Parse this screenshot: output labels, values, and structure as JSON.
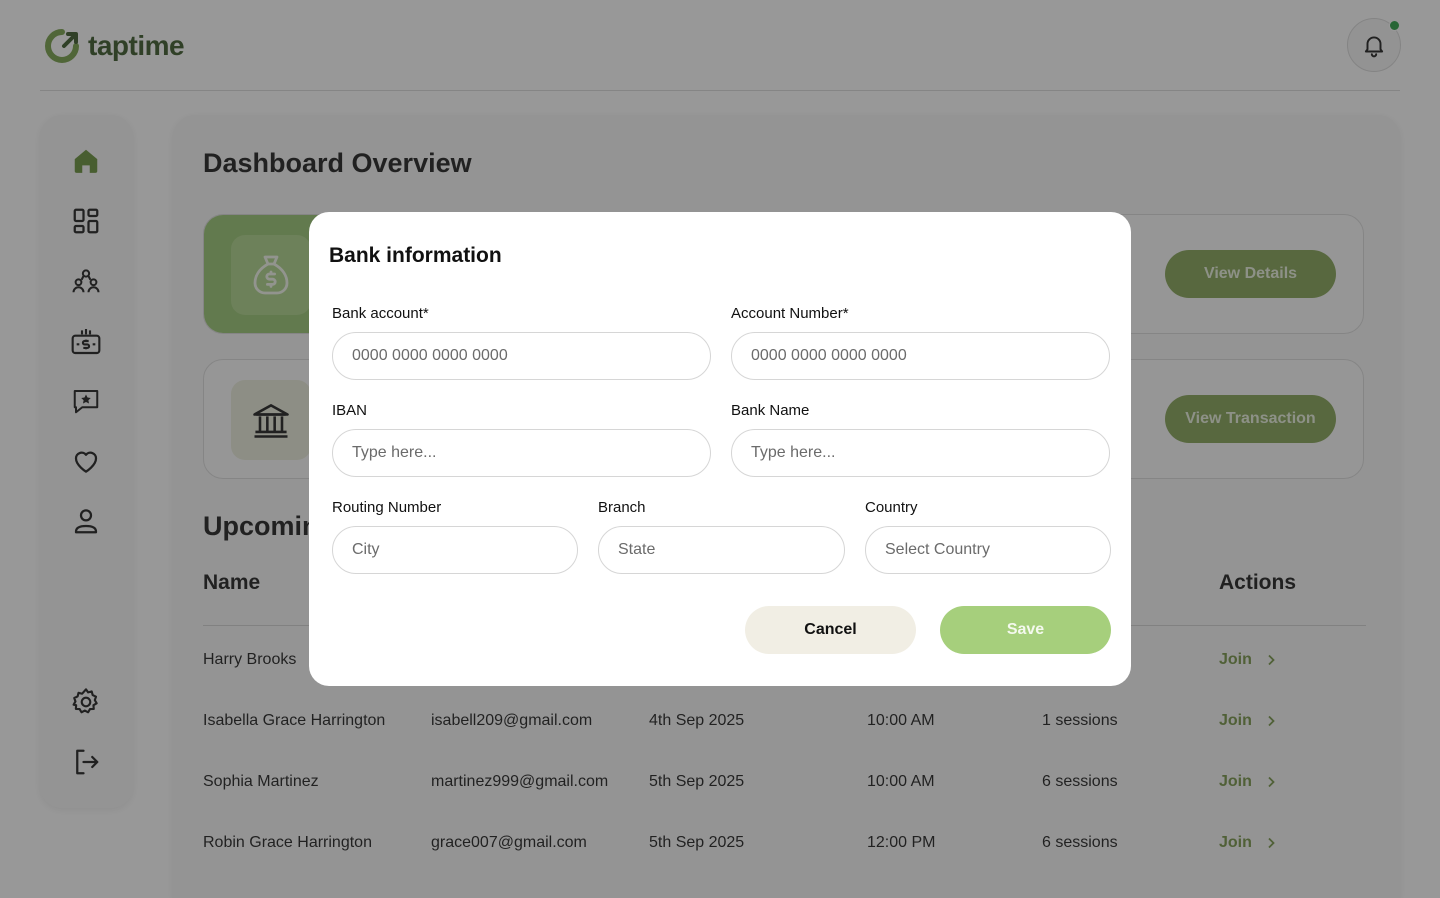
{
  "app": {
    "name": "taptime"
  },
  "colors": {
    "brand_green": "#7f9f4d",
    "accent_light_green": "#a6cf7c",
    "notification_dot": "#1f9a3b"
  },
  "header": {
    "notification_icon": "bell-icon"
  },
  "sidebar": {
    "items": [
      {
        "icon": "home-icon",
        "active": true
      },
      {
        "icon": "dashboard-grid-icon"
      },
      {
        "icon": "users-icon"
      },
      {
        "icon": "payments-icon"
      },
      {
        "icon": "reviews-icon"
      },
      {
        "icon": "favorites-icon"
      },
      {
        "icon": "profile-icon"
      }
    ],
    "bottom_items": [
      {
        "icon": "settings-icon"
      },
      {
        "icon": "logout-icon"
      }
    ]
  },
  "main": {
    "title": "Dashboard Overview",
    "cards": [
      {
        "icon": "money-bag-icon",
        "button": "View Details"
      },
      {
        "icon": "bank-icon",
        "button": "View Transaction"
      }
    ],
    "section_title": "Upcomin",
    "table": {
      "headers": {
        "name": "Name",
        "actions": "Actions"
      },
      "rows": [
        {
          "name": "Harry Brooks",
          "email": "",
          "date": "",
          "time": "",
          "sessions": "",
          "action": "Join"
        },
        {
          "name": "Isabella Grace Harrington",
          "email": "isabell209@gmail.com",
          "date": "4th Sep 2025",
          "time": "10:00 AM",
          "sessions": "1 sessions",
          "action": "Join"
        },
        {
          "name": "Sophia Martinez",
          "email": "martinez999@gmail.com",
          "date": "5th Sep 2025",
          "time": "10:00 AM",
          "sessions": "6 sessions",
          "action": "Join"
        },
        {
          "name": "Robin Grace Harrington",
          "email": "grace007@gmail.com",
          "date": "5th Sep 2025",
          "time": "12:00 PM",
          "sessions": "6 sessions",
          "action": "Join"
        }
      ]
    }
  },
  "modal": {
    "title": "Bank information",
    "fields": {
      "bank_account": {
        "label": "Bank account*",
        "placeholder": "0000 0000 0000 0000",
        "value": ""
      },
      "account_number": {
        "label": "Account Number*",
        "placeholder": "0000 0000 0000 0000",
        "value": ""
      },
      "iban": {
        "label": "IBAN",
        "placeholder": "Type here...",
        "value": ""
      },
      "bank_name": {
        "label": "Bank Name",
        "placeholder": "Type here...",
        "value": ""
      },
      "routing_number": {
        "label": "Routing Number",
        "placeholder": "City",
        "value": ""
      },
      "branch": {
        "label": "Branch",
        "placeholder": "State",
        "value": ""
      },
      "country": {
        "label": "Country",
        "placeholder": "Select Country",
        "value": ""
      }
    },
    "cancel_label": "Cancel",
    "save_label": "Save"
  }
}
